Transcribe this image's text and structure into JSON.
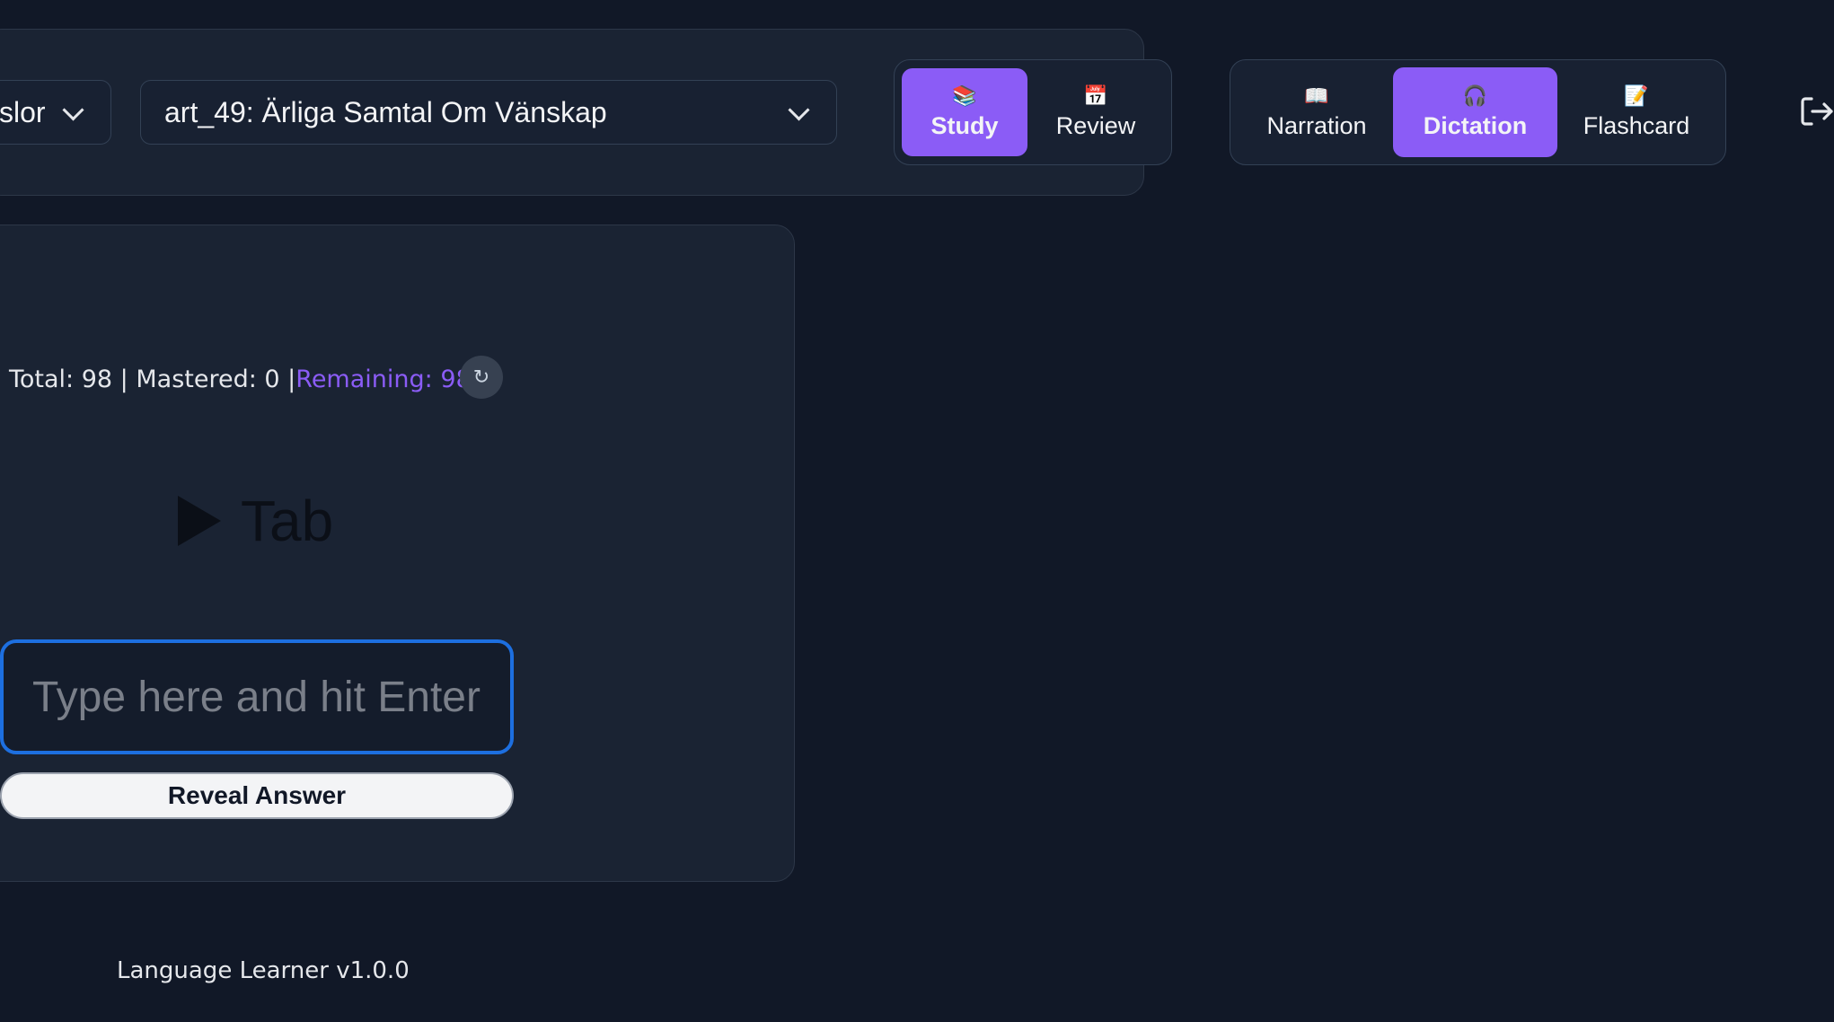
{
  "selectors": {
    "language_value": "slor",
    "article_value": "art_49: Ärliga Samtal Om Vänskap"
  },
  "mode_tabs": [
    {
      "icon": "📚",
      "label": "Study",
      "active": true
    },
    {
      "icon": "📅",
      "label": "Review",
      "active": false
    }
  ],
  "exercise_tabs": [
    {
      "icon": "📖",
      "label": "Narration",
      "active": false
    },
    {
      "icon": "🎧",
      "label": "Dictation",
      "active": true
    },
    {
      "icon": "📝",
      "label": "Flashcard",
      "active": false
    }
  ],
  "stats": {
    "text": "Total: 98 | Mastered: 0 | ",
    "remaining": "Remaining: 98",
    "refresh_glyph": "↻"
  },
  "prompt": {
    "word": "Tab"
  },
  "answer": {
    "value": "",
    "placeholder": "Type here and hit Enter"
  },
  "reveal": {
    "label": "Reveal Answer"
  },
  "footer": {
    "text": "Language Learner v1.0.0"
  },
  "colors": {
    "background": "#111827",
    "accent": "#8b5cf6",
    "focus": "#1d6fe0"
  }
}
